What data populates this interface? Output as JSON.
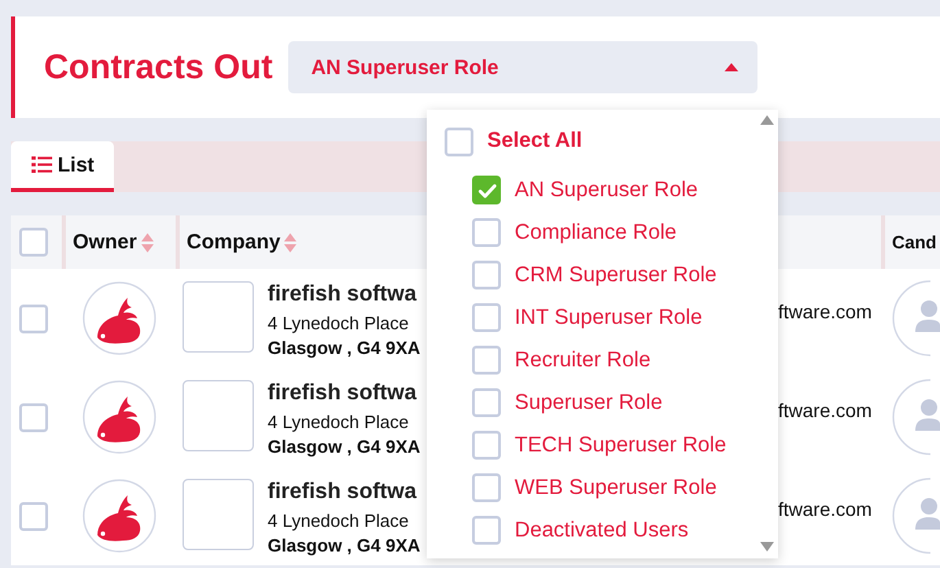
{
  "header": {
    "title": "Contracts Out",
    "role_select": {
      "value": "AN Superuser Role",
      "expanded": true
    }
  },
  "views": [
    {
      "label": "List",
      "selected": true
    }
  ],
  "table": {
    "select_all_checked": false,
    "columns": [
      {
        "label": "Owner",
        "sortable": true
      },
      {
        "label": "Company",
        "sortable": true
      },
      {
        "label": "Cand"
      }
    ],
    "rows": [
      {
        "checked": false,
        "company_name": "firefish softwa",
        "address_line": "4 Lynedoch Place",
        "city_line": "Glasgow , G4 9XA",
        "email": "ftware.com"
      },
      {
        "checked": false,
        "company_name": "firefish softwa",
        "address_line": "4 Lynedoch Place",
        "city_line": "Glasgow , G4 9XA",
        "email": "ftware.com"
      },
      {
        "checked": false,
        "company_name": "firefish softwa",
        "address_line": "4 Lynedoch Place",
        "city_line": "Glasgow , G4 9XA",
        "email": "ftware.com"
      }
    ]
  },
  "role_menu": {
    "select_all": {
      "label": "Select All",
      "checked": false
    },
    "options": [
      {
        "label": "AN Superuser Role",
        "checked": true
      },
      {
        "label": "Compliance Role",
        "checked": false
      },
      {
        "label": "CRM Superuser Role",
        "checked": false
      },
      {
        "label": "INT Superuser Role",
        "checked": false
      },
      {
        "label": "Recruiter Role",
        "checked": false
      },
      {
        "label": "Superuser Role",
        "checked": false
      },
      {
        "label": "TECH Superuser Role",
        "checked": false
      },
      {
        "label": "WEB Superuser Role",
        "checked": false
      },
      {
        "label": "Deactivated Users",
        "checked": false
      }
    ]
  }
}
